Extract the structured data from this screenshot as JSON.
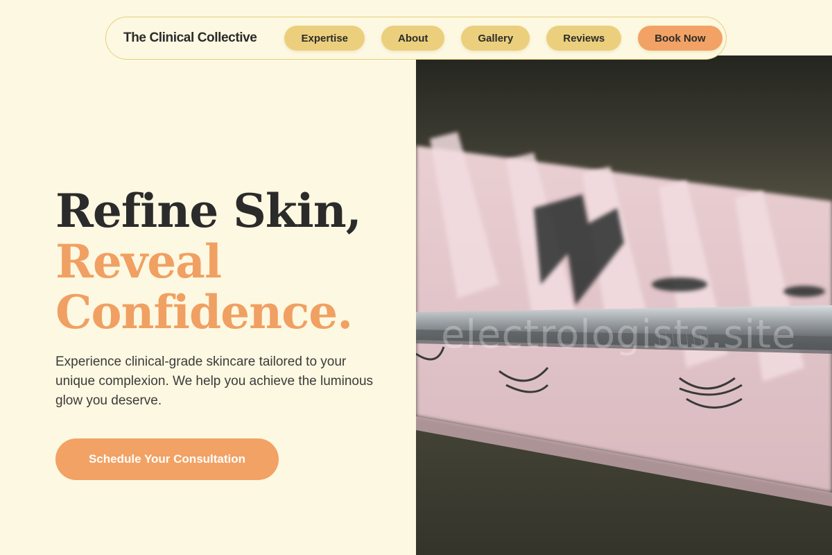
{
  "nav": {
    "brand": "The Clinical Collective",
    "links": [
      {
        "label": "Expertise"
      },
      {
        "label": "About"
      },
      {
        "label": "Gallery"
      },
      {
        "label": "Reviews"
      }
    ],
    "cta_label": "Book Now"
  },
  "hero": {
    "headline_line1": "Refine Skin,",
    "headline_line2": "Reveal",
    "headline_line3": "Confidence.",
    "subcopy": "Experience clinical-grade skincare tailored to your unique complexion. We help you achieve the luminous glow you deserve.",
    "cta_label": "Schedule Your Consultation",
    "image_watermark": "electrologists.site"
  },
  "colors": {
    "background": "#fdf8e1",
    "nav_button": "#ebcf7c",
    "accent": "#f0a062",
    "text_dark": "#2b2b2b"
  }
}
